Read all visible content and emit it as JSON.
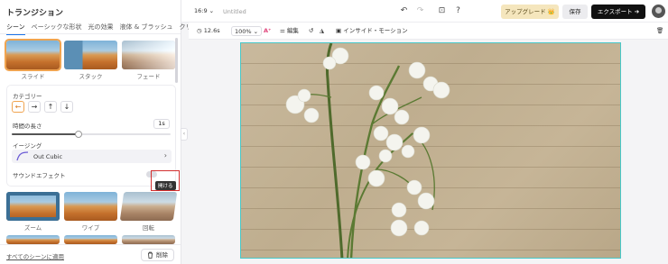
{
  "panel": {
    "title": "トランジション",
    "tabs": [
      "シーン",
      "ベーシックな形状",
      "光の効果",
      "液体 & ブラッシュ",
      "クリ"
    ],
    "thumbs_row1": [
      {
        "label": "スライド",
        "selected": true
      },
      {
        "label": "スタック",
        "selected": false
      },
      {
        "label": "フェード",
        "selected": false
      }
    ],
    "thumbs_row2": [
      {
        "label": "ズーム"
      },
      {
        "label": "ワイプ"
      },
      {
        "label": "回転"
      }
    ],
    "category_label": "カテゴリー",
    "directions": [
      "←",
      "→",
      "↑",
      "↓"
    ],
    "active_direction": "←",
    "duration_label": "時間の長さ",
    "duration_value": "1s",
    "duration_fraction": 0.42,
    "easing_label": "イージング",
    "easing_value": "Out Cubic",
    "sound_label": "サウンドエフェクト",
    "tooltip": "開ける",
    "apply_all": "すべてのシーンに適用",
    "delete": "削除"
  },
  "topbar": {
    "ratio": "16:9",
    "title": "Untitled",
    "upgrade": "アップグレード 👑",
    "save": "保存",
    "export": "エクスポート ➔"
  },
  "toolbar2": {
    "duration": "12.6s",
    "zoom": "100%",
    "edit": "編集",
    "motion": "インサイド・モーション"
  },
  "colors": {
    "accent_selected": "#f0a450",
    "canvas_border": "#48c8c8",
    "highlight_box": "#d32f2f"
  }
}
